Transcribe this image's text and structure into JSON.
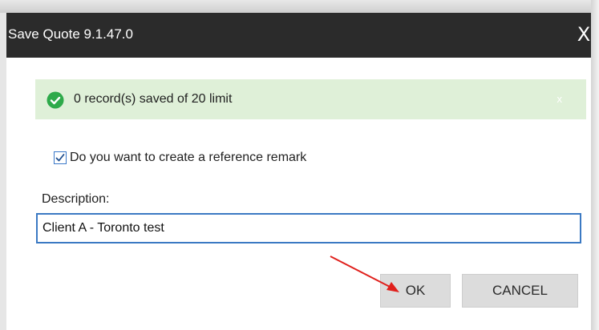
{
  "window": {
    "title": "Save Quote 9.1.47.0",
    "close_glyph": "X"
  },
  "alert": {
    "icon": "check-circle-icon",
    "message": "0 record(s) saved of 20 limit",
    "dismiss_glyph": "x",
    "background": "#dff0d8",
    "icon_color": "#2eaa4a"
  },
  "remark_checkbox": {
    "checked": true,
    "label": "Do you want to create a reference remark"
  },
  "description": {
    "label": "Description:",
    "value": "Client A - Toronto test"
  },
  "buttons": {
    "ok_label": "OK",
    "cancel_label": "CANCEL"
  },
  "annotation": {
    "arrow_color": "#e0201c"
  }
}
